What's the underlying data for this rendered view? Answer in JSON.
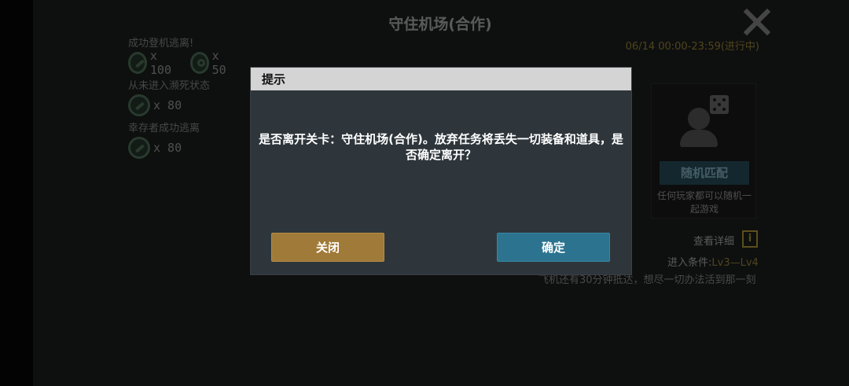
{
  "title": "守住机场(合作)",
  "date": "06/14 00:00-23:59(进行中)",
  "rewards": [
    {
      "label": "成功登机逃离!",
      "items": [
        {
          "icon": "wrench-icon",
          "count": "x 100"
        },
        {
          "icon": "gear-icon",
          "count": "x 50"
        }
      ]
    },
    {
      "label": "从未进入濒死状态",
      "items": [
        {
          "icon": "wrench-icon",
          "count": "x 80"
        }
      ]
    },
    {
      "label": "幸存者成功逃离",
      "items": [
        {
          "icon": "wrench-icon",
          "count": "x 80"
        }
      ]
    }
  ],
  "match": {
    "button": "随机匹配",
    "desc": "任何玩家都可以随机一起游戏"
  },
  "detail": "查看详细",
  "info_glyph": "i",
  "condition_label": "进入条件:",
  "condition_value": "Lv3—Lv4",
  "story": "飞机还有30分钟抵达，想尽一切办法活到那一刻",
  "modal": {
    "title": "提示",
    "message": "是否离开关卡：守住机场(合作)。放弃任务将丢失一切装备和道具，是否确定离开？",
    "close_label": "关闭",
    "ok_label": "确定"
  }
}
